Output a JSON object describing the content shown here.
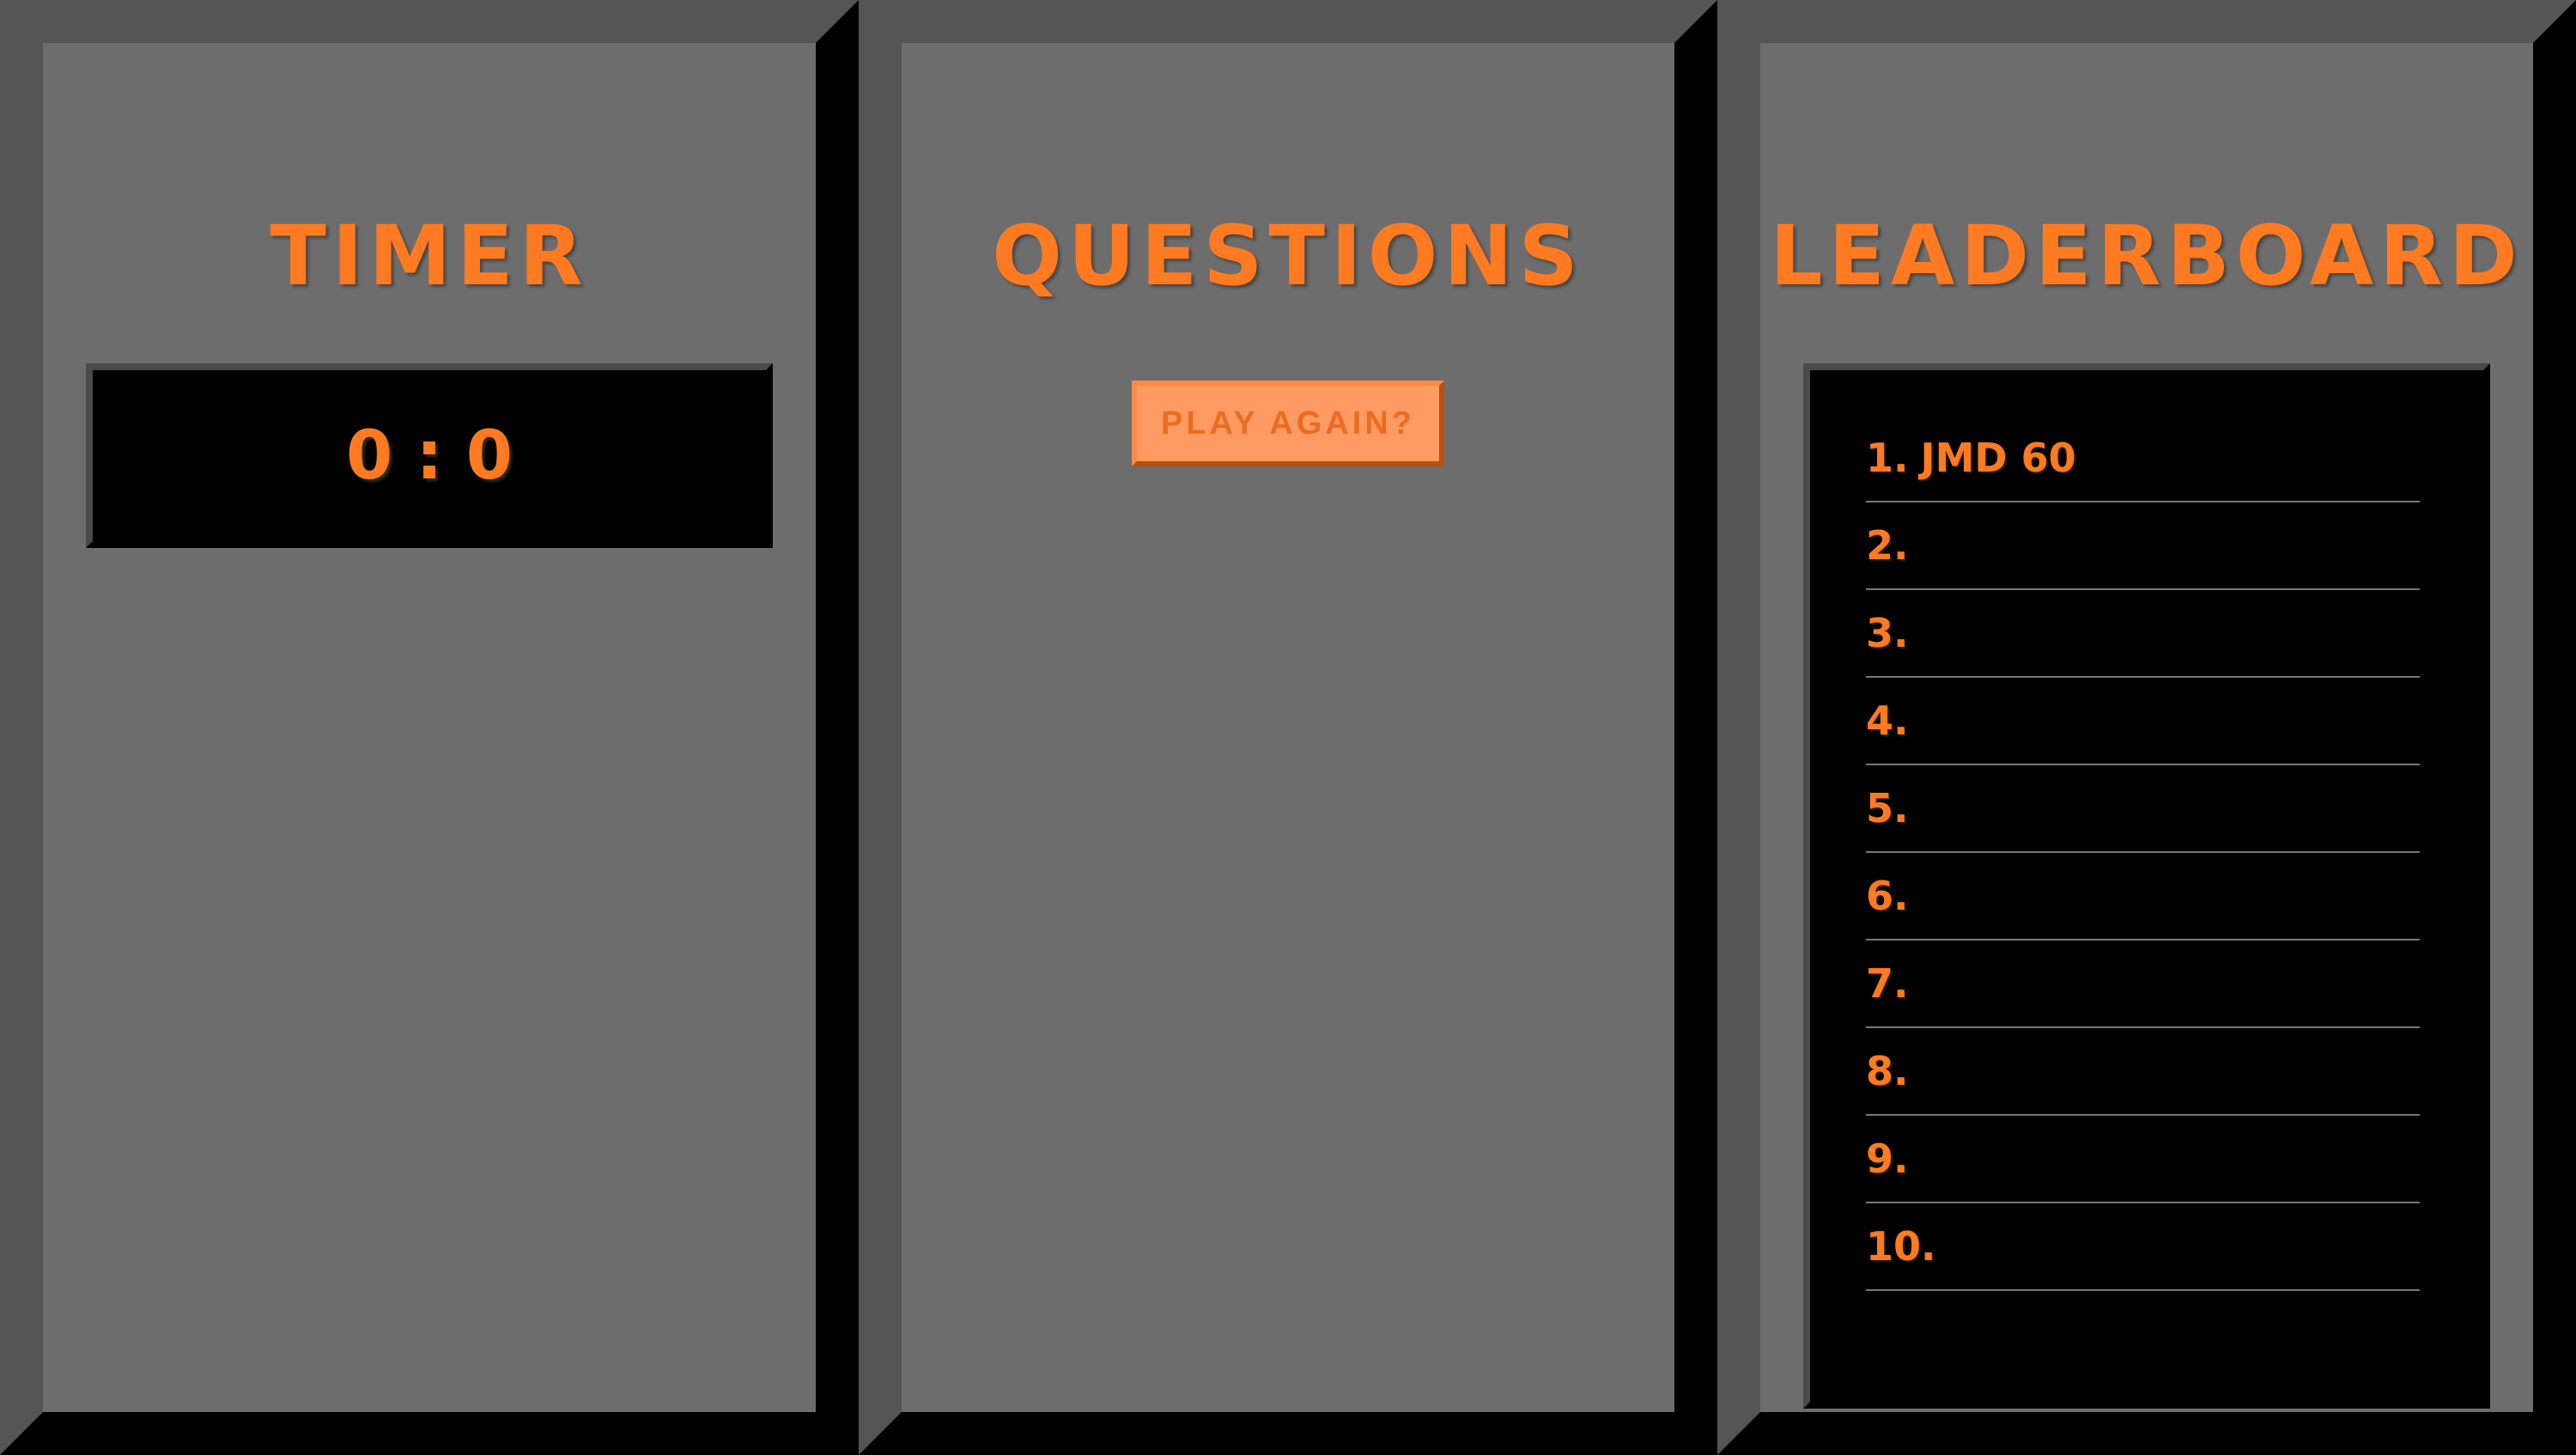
{
  "colors": {
    "accent": "#ff7a21",
    "panel_bg": "#6d6d6d",
    "bevel_light": "#555555",
    "bevel_dark": "#000000",
    "button_bg": "#ff9b62"
  },
  "timer": {
    "title": "TIMER",
    "value": "0 : 0"
  },
  "questions": {
    "title": "QUESTIONS",
    "play_again_label": "PLAY AGAIN?"
  },
  "leaderboard": {
    "title": "LEADERBOARD",
    "entries": [
      {
        "rank": "1.",
        "entry": "JMD 60"
      },
      {
        "rank": "2.",
        "entry": ""
      },
      {
        "rank": "3.",
        "entry": ""
      },
      {
        "rank": "4.",
        "entry": ""
      },
      {
        "rank": "5.",
        "entry": ""
      },
      {
        "rank": "6.",
        "entry": ""
      },
      {
        "rank": "7.",
        "entry": ""
      },
      {
        "rank": "8.",
        "entry": ""
      },
      {
        "rank": "9.",
        "entry": ""
      },
      {
        "rank": "10.",
        "entry": ""
      }
    ]
  }
}
